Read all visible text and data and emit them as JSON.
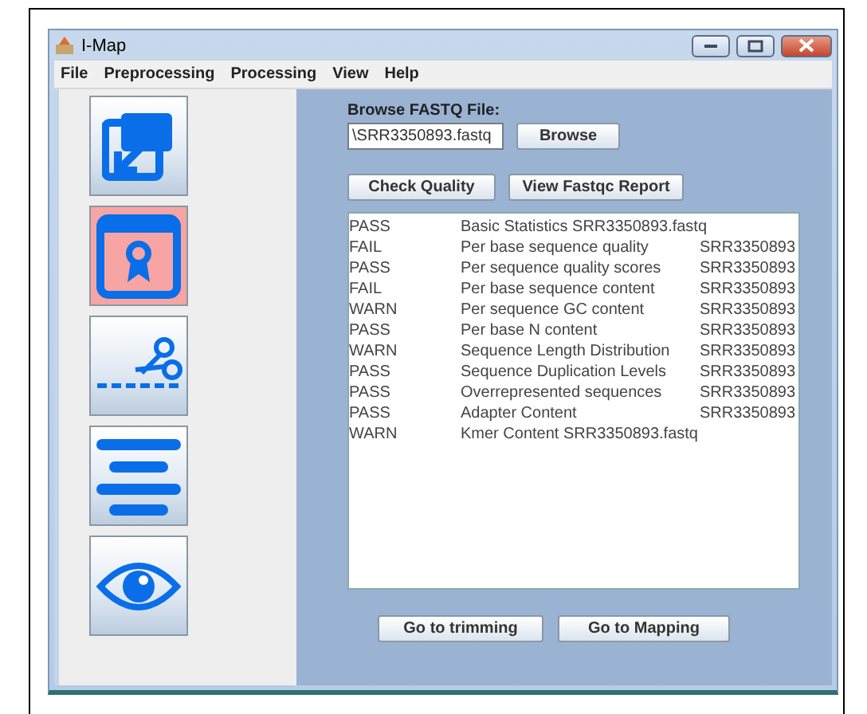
{
  "window": {
    "title": "I-Map"
  },
  "menu": [
    "File",
    "Preprocessing",
    "Processing",
    "View",
    "Help"
  ],
  "tools": [
    {
      "kind": "import",
      "selected": false
    },
    {
      "kind": "certificate",
      "selected": true
    },
    {
      "kind": "scissors",
      "selected": false
    },
    {
      "kind": "lines",
      "selected": false
    },
    {
      "kind": "eye",
      "selected": false
    }
  ],
  "file_label": "Browse FASTQ File:",
  "file_field": {
    "value": "\\SRR3350893.fastq"
  },
  "browse_button": "Browse",
  "action_buttons": [
    "Check Quality",
    "View Fastqc Report"
  ],
  "results": [
    {
      "status": "PASS",
      "test": "Basic Statistics  SRR3350893.fastq"
    },
    {
      "status": "FAIL",
      "test": "Per base sequence quality",
      "file": "SRR3350893"
    },
    {
      "status": "PASS",
      "test": "Per sequence quality scores",
      "file": "SRR3350893"
    },
    {
      "status": "FAIL",
      "test": "Per base sequence content",
      "file": "SRR3350893"
    },
    {
      "status": "WARN",
      "test": "Per sequence GC content",
      "file": "SRR3350893"
    },
    {
      "status": "PASS",
      "test": "Per base N content",
      "file": "SRR3350893"
    },
    {
      "status": "WARN",
      "test": "Sequence Length Distribution",
      "file": "SRR3350893"
    },
    {
      "status": "PASS",
      "test": "Sequence Duplication Levels",
      "file": "SRR3350893"
    },
    {
      "status": "PASS",
      "test": "Overrepresented sequences",
      "file": "SRR3350893"
    },
    {
      "status": "PASS",
      "test": "Adapter Content",
      "file": "SRR3350893"
    },
    {
      "status": "WARN",
      "test": "Kmer Content  SRR3350893.fastq"
    }
  ],
  "nav_buttons": [
    "Go to trimming",
    "Go to Mapping"
  ]
}
